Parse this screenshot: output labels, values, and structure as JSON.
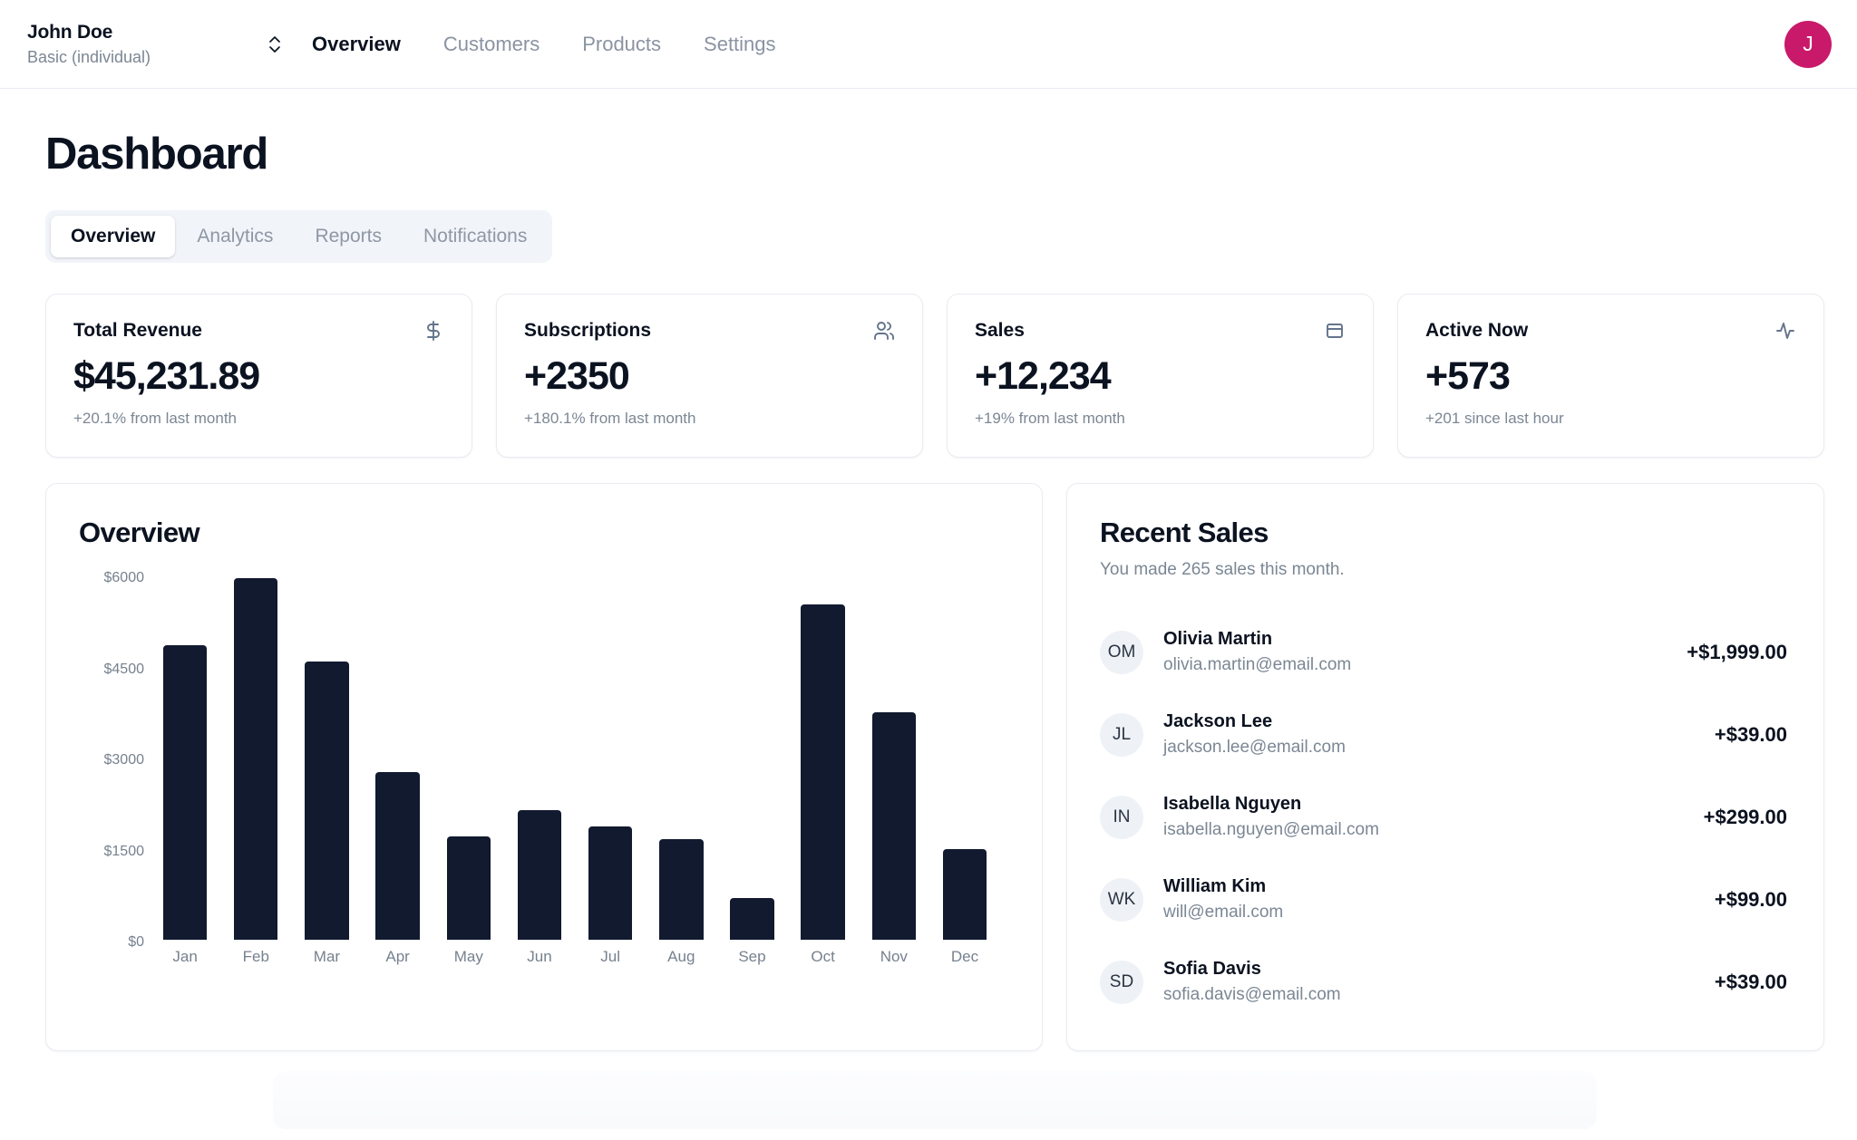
{
  "topbar": {
    "team": {
      "name": "John Doe",
      "plan": "Basic (individual)"
    },
    "switcher_icon": "chevrons-up-down-icon",
    "nav": [
      {
        "label": "Overview",
        "active": true
      },
      {
        "label": "Customers",
        "active": false
      },
      {
        "label": "Products",
        "active": false
      },
      {
        "label": "Settings",
        "active": false
      }
    ],
    "avatar": {
      "initial": "J",
      "color": "#c9196a"
    }
  },
  "page": {
    "title": "Dashboard",
    "tabs": [
      {
        "label": "Overview",
        "active": true
      },
      {
        "label": "Analytics",
        "active": false
      },
      {
        "label": "Reports",
        "active": false
      },
      {
        "label": "Notifications",
        "active": false
      }
    ]
  },
  "stats": [
    {
      "title": "Total Revenue",
      "value": "$45,231.89",
      "sub": "+20.1% from last month",
      "icon": "dollar-sign-icon"
    },
    {
      "title": "Subscriptions",
      "value": "+2350",
      "sub": "+180.1% from last month",
      "icon": "users-icon"
    },
    {
      "title": "Sales",
      "value": "+12,234",
      "sub": "+19% from last month",
      "icon": "credit-card-icon"
    },
    {
      "title": "Active Now",
      "value": "+573",
      "sub": "+201 since last hour",
      "icon": "activity-icon"
    }
  ],
  "overview_panel": {
    "title": "Overview"
  },
  "recent_sales": {
    "title": "Recent Sales",
    "subtitle": "You made 265 sales this month.",
    "rows": [
      {
        "initials": "OM",
        "name": "Olivia Martin",
        "email": "olivia.martin@email.com",
        "amount": "+$1,999.00"
      },
      {
        "initials": "JL",
        "name": "Jackson Lee",
        "email": "jackson.lee@email.com",
        "amount": "+$39.00"
      },
      {
        "initials": "IN",
        "name": "Isabella Nguyen",
        "email": "isabella.nguyen@email.com",
        "amount": "+$299.00"
      },
      {
        "initials": "WK",
        "name": "William Kim",
        "email": "will@email.com",
        "amount": "+$99.00"
      },
      {
        "initials": "SD",
        "name": "Sofia Davis",
        "email": "sofia.davis@email.com",
        "amount": "+$39.00"
      }
    ]
  },
  "chart_data": {
    "type": "bar",
    "title": "Overview",
    "xlabel": "",
    "ylabel": "",
    "categories": [
      "Jan",
      "Feb",
      "Mar",
      "Apr",
      "May",
      "Jun",
      "Jul",
      "Aug",
      "Sep",
      "Oct",
      "Nov",
      "Dec"
    ],
    "values": [
      4930,
      5980,
      4680,
      2970,
      1980,
      2390,
      2140,
      1940,
      1030,
      5550,
      3900,
      1780
    ],
    "ytick_labels": [
      "$0",
      "$1500",
      "$3000",
      "$4500",
      "$6000"
    ],
    "ytick_values": [
      0,
      1500,
      3000,
      4500,
      6000
    ],
    "ylim": [
      0,
      6000
    ],
    "grid": false,
    "legend": "none",
    "bar_color": "#111a2e"
  }
}
